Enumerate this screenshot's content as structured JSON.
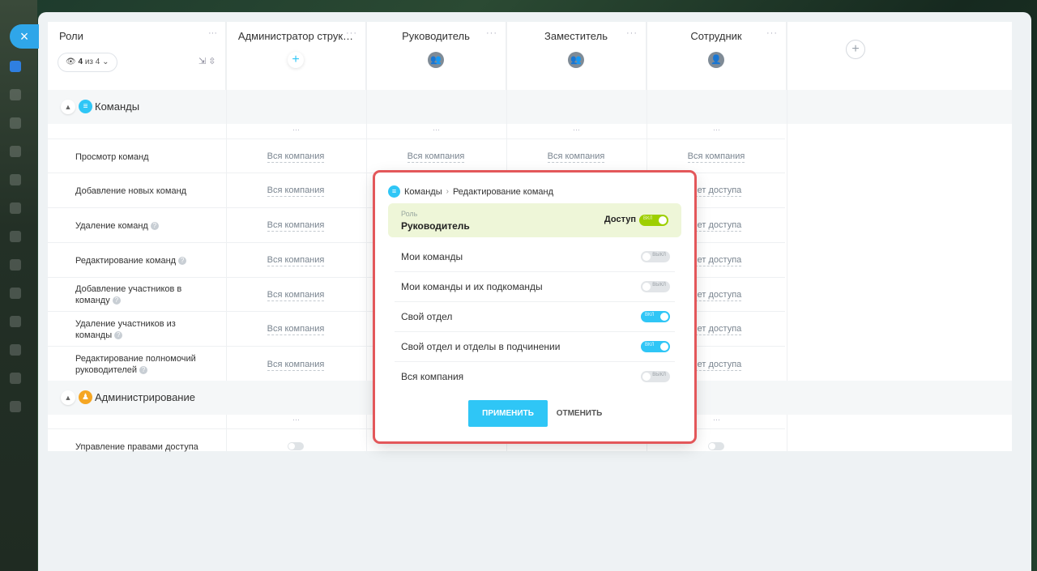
{
  "close_label": "×",
  "table": {
    "roles_title": "Роли",
    "filter": {
      "count": "4",
      "of": "из 4"
    },
    "columns": [
      {
        "title": "Администратор струк…",
        "icon": "plus-icon"
      },
      {
        "title": "Руководитель",
        "icon": "group-icon"
      },
      {
        "title": "Заместитель",
        "icon": "group-icon"
      },
      {
        "title": "Сотрудник",
        "icon": "user-icon"
      }
    ],
    "sections": [
      {
        "label": "Команды",
        "color": "#2fc6f6"
      },
      {
        "label": "Администрирование",
        "color": "#f5a623"
      }
    ],
    "permissions": [
      {
        "label": "Просмотр команд",
        "values": [
          "Вся компания",
          "Вся компания",
          "Вся компания",
          "Вся компания"
        ]
      },
      {
        "label": "Добавление новых команд",
        "values": [
          "Вся компания",
          "",
          "",
          "Нет доступа"
        ]
      },
      {
        "label": "Удаление команд",
        "values": [
          "Вся компания",
          "",
          "",
          "Нет доступа"
        ]
      },
      {
        "label": "Редактирование команд",
        "values": [
          "Вся компания",
          "",
          "",
          "Нет доступа"
        ]
      },
      {
        "label": "Добавление участников в команду",
        "values": [
          "Вся компания",
          "",
          "",
          "Нет доступа"
        ]
      },
      {
        "label": "Удаление участников из команды",
        "values": [
          "Вся компания",
          "",
          "",
          "Нет доступа"
        ]
      },
      {
        "label": "Редактирование полномочий руководителей",
        "values": [
          "Вся компания",
          "",
          "",
          "Нет доступа"
        ]
      }
    ],
    "admin_permission": "Управление правами доступа"
  },
  "popup": {
    "breadcrumb": [
      "Команды",
      "Редактирование команд"
    ],
    "role_caption": "Роль",
    "role_name": "Руководитель",
    "access_label": "Доступ",
    "access_on": true,
    "toggle_on_text": "вкл",
    "toggle_off_text": "выкл",
    "options": [
      {
        "label": "Мои команды",
        "on": false
      },
      {
        "label": "Мои команды и их подкоманды",
        "on": false
      },
      {
        "label": "Свой отдел",
        "on": true
      },
      {
        "label": "Свой отдел и отделы в подчинении",
        "on": true
      },
      {
        "label": "Вся компания",
        "on": false
      }
    ],
    "apply_label": "ПРИМЕНИТЬ",
    "cancel_label": "ОТМЕНИТЬ"
  }
}
